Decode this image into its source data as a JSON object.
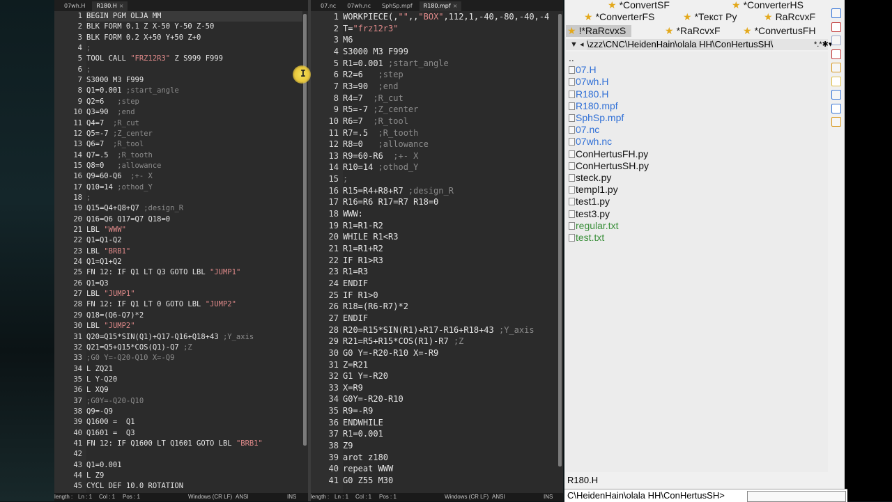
{
  "left_editor": {
    "tabs": [
      {
        "label": "07wh.H",
        "active": false
      },
      {
        "label": "R180.H",
        "active": true
      }
    ],
    "close_glyph": "×",
    "lines": [
      "BEGIN PGM OLJA MM",
      "BLK FORM 0.1 Z X-50 Y-50 Z-50",
      "BLK FORM 0.2 X+50 Y+50 Z+0",
      ";",
      "TOOL CALL \"FRZ12R3\" Z S999 F999",
      ";",
      "S3000 M3 F999",
      "Q1=0.001 ;start_angle",
      "Q2=6   ;step",
      "Q3=90  ;end",
      "Q4=7  ;R_cut",
      "Q5=-7 ;Z_center",
      "Q6=7  ;R_tool",
      "Q7=.5  ;R_tooth",
      "Q8=0   ;allowance",
      "Q9=60-Q6  ;+- X",
      "Q10=14 ;othod_Y",
      ";",
      "Q15=Q4+Q8+Q7 ;design_R",
      "Q16=Q6 Q17=Q7 Q18=0",
      "LBL \"WWW\"",
      "Q1=Q1-Q2",
      "LBL \"BRB1\"",
      "Q1=Q1+Q2",
      "FN 12: IF Q1 LT Q3 GOTO LBL \"JUMP1\"",
      "Q1=Q3",
      "LBL \"JUMP1\"",
      "FN 12: IF Q1 LT 0 GOTO LBL \"JUMP2\"",
      "Q18=(Q6-Q7)*2",
      "LBL \"JUMP2\"",
      "Q20=Q15*SIN(Q1)+Q17-Q16+Q18+43 ;Y_axis",
      "Q21=Q5+Q15*COS(Q1)-Q7 ;Z",
      ";G0 Y=-Q20-Q10 X=-Q9",
      "L ZQ21",
      "L Y-Q20",
      "L XQ9",
      ";G0Y=-Q20-Q10",
      "Q9=-Q9",
      "Q1600 =  Q1",
      "Q1601 =  Q3",
      "FN 12: IF Q1600 LT Q1601 GOTO LBL \"BRB1\"",
      "",
      "Q1=0.001",
      "L Z9",
      "CYCL DEF 10.0 ROTATION"
    ],
    "status": {
      "length": "length : ",
      "ln": "Ln : 1",
      "col": "Col : 1",
      "pos": "Pos : 1",
      "eol": "Windows (CR LF)",
      "enc": "ANSI",
      "mode": "INS"
    }
  },
  "right_editor": {
    "tabs": [
      {
        "label": "07.nc",
        "active": false
      },
      {
        "label": "07wh.nc",
        "active": false
      },
      {
        "label": "SphSp.mpf",
        "active": false
      },
      {
        "label": "R180.mpf",
        "active": true
      }
    ],
    "close_glyph": "×",
    "lines": [
      "WORKPIECE(,\"\",,\"BOX\",112,1,-40,-80,-40,-4",
      "T=\"frz12r3\"",
      "M6",
      "S3000 M3 F999",
      "R1=0.001 ;start_angle",
      "R2=6   ;step",
      "R3=90  ;end",
      "R4=7  ;R_cut",
      "R5=-7 ;Z_center",
      "R6=7  ;R_tool",
      "R7=.5  ;R_tooth",
      "R8=0   ;allowance",
      "R9=60-R6  ;+- X",
      "R10=14 ;othod_Y",
      ";",
      "R15=R4+R8+R7 ;design_R",
      "R16=R6 R17=R7 R18=0",
      "WWW:",
      "R1=R1-R2",
      "WHILE R1<R3",
      "R1=R1+R2",
      "IF R1>R3",
      "R1=R3",
      "ENDIF",
      "IF R1>0",
      "R18=(R6-R7)*2",
      "ENDIF",
      "R20=R15*SIN(R1)+R17-R16+R18+43 ;Y_axis",
      "R21=R5+R15*COS(R1)-R7 ;Z",
      "G0 Y=-R20-R10 X=-R9",
      "Z=R21",
      "G1 Y=-R20",
      "X=R9",
      "G0Y=-R20-R10",
      "R9=-R9",
      "ENDWHILE",
      "R1=0.001",
      "Z9",
      "arot z180",
      "repeat WWW",
      "G0 Z55 M30"
    ],
    "status": {
      "length": "length : ",
      "ln": "Ln : 1",
      "col": "Col : 1",
      "pos": "Pos : 1",
      "eol": "Windows (CR LF)",
      "enc": "ANSI",
      "mode": "INS"
    }
  },
  "cursor_glyph": "I",
  "file_panel": {
    "tabs": [
      {
        "label": "*ConvertSF",
        "star": true,
        "selected": false
      },
      {
        "label": "*ConverterHS",
        "star": true,
        "selected": false
      },
      {
        "label": "*ConverterFS",
        "star": true,
        "selected": false
      },
      {
        "label": "*Текст Ру",
        "star": true,
        "selected": false
      },
      {
        "label": "RaRcvxF",
        "star": true,
        "selected": false
      },
      {
        "label": "!*RaRcvxS",
        "star": true,
        "selected": true
      },
      {
        "label": "*RaRcvxF",
        "star": true,
        "selected": false
      },
      {
        "label": "*ConvertusFH",
        "star": true,
        "selected": false
      }
    ],
    "star_glyph": "★",
    "nav_glyph": "▼ ◂",
    "path": "\\zzz\\CNC\\HeidenHain\\olala HH\\ConHertusSH\\",
    "mask": "*.*",
    "mask_arrow": "✱▾",
    "files": [
      {
        "name": "..",
        "color": "#111111",
        "icon": false
      },
      {
        "name": "07.H",
        "color": "#2f6fd6",
        "icon": true
      },
      {
        "name": "07wh.H",
        "color": "#2f6fd6",
        "icon": true
      },
      {
        "name": "R180.H",
        "color": "#2f6fd6",
        "icon": true
      },
      {
        "name": "R180.mpf",
        "color": "#2f6fd6",
        "icon": true
      },
      {
        "name": "SphSp.mpf",
        "color": "#2f6fd6",
        "icon": true
      },
      {
        "name": "07.nc",
        "color": "#2f6fd6",
        "icon": true
      },
      {
        "name": "07wh.nc",
        "color": "#2f6fd6",
        "icon": true
      },
      {
        "name": "ConHertusFH.py",
        "color": "#111111",
        "icon": true
      },
      {
        "name": "ConHertusSH.py",
        "color": "#111111",
        "icon": true
      },
      {
        "name": "steck.py",
        "color": "#111111",
        "icon": true
      },
      {
        "name": "templ1.py",
        "color": "#111111",
        "icon": true
      },
      {
        "name": "test1.py",
        "color": "#111111",
        "icon": true
      },
      {
        "name": "test3.py",
        "color": "#111111",
        "icon": true
      },
      {
        "name": "regular.txt",
        "color": "#3a8f3a",
        "icon": true
      },
      {
        "name": "test.txt",
        "color": "#3a8f3a",
        "icon": true
      }
    ],
    "side_icons": [
      "search-icon",
      "find-file-icon",
      "copy-icon",
      "delete-icon",
      "pack-icon",
      "folder-icon",
      "panel-icon",
      "panel-alt-icon",
      "list-icon"
    ],
    "selected_file": "R180.H",
    "command_path": "C\\HeidenHain\\olala HH\\ConHertusSH>"
  },
  "colors": {
    "editor_bg": "#2b2b2b",
    "string": "#e08a8a",
    "number": "#6aa0e0",
    "comment": "#8c8c8c",
    "folder_link": "#2f6fd6",
    "text_file": "#3a8f3a"
  }
}
